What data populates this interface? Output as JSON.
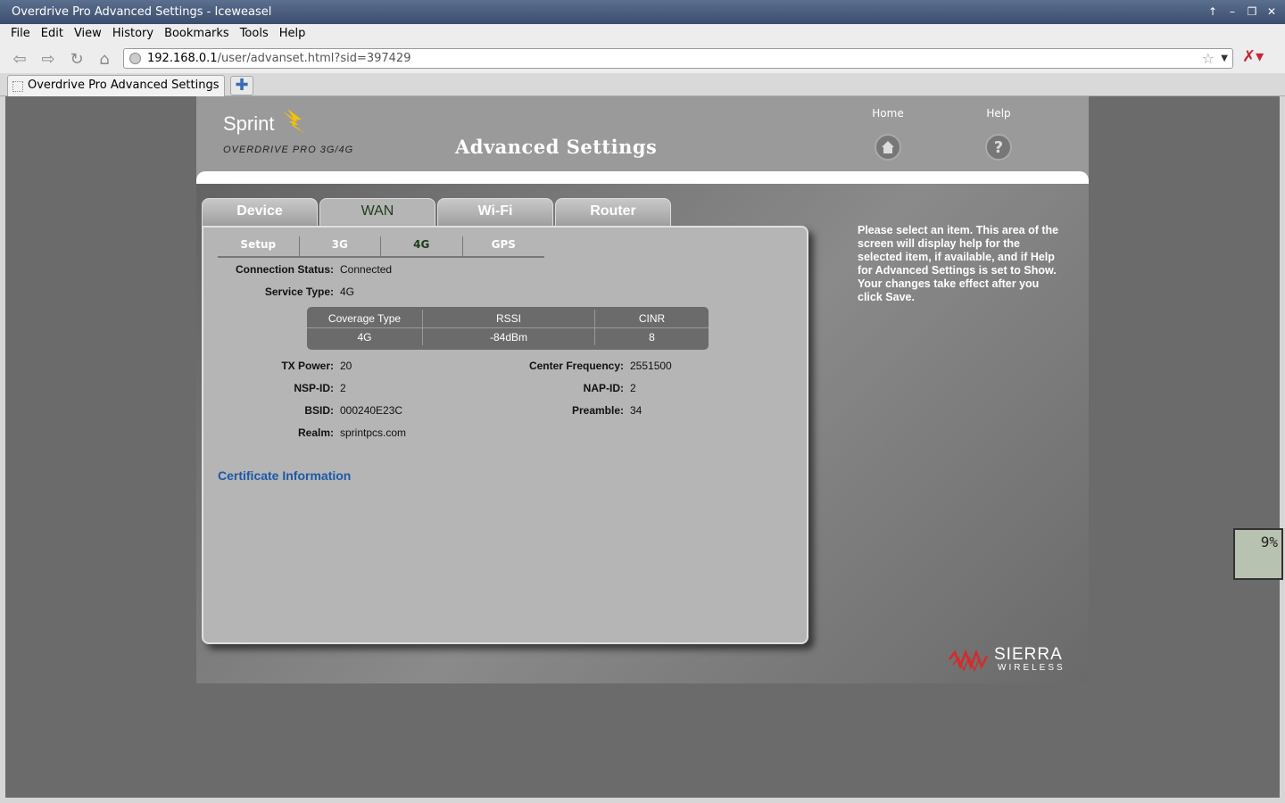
{
  "window": {
    "title": "Overdrive Pro Advanced Settings - Iceweasel"
  },
  "menu": {
    "items": [
      "File",
      "Edit",
      "View",
      "History",
      "Bookmarks",
      "Tools",
      "Help"
    ]
  },
  "nav": {
    "url_host": "192.168.0.1",
    "url_path": "/user/advanset.html?sid=397429"
  },
  "browser_tab": {
    "label": "Overdrive Pro Advanced Settings",
    "new_tab_glyph": "✚"
  },
  "page": {
    "brand": "Sprint",
    "product_logo": "OVERDRIVE PRO 3G/4G",
    "title": "Advanced Settings",
    "home_label": "Home",
    "help_label": "Help",
    "tabs": [
      "Device",
      "WAN",
      "Wi-Fi",
      "Router"
    ],
    "active_tab": "WAN",
    "subtabs": [
      "Setup",
      "3G",
      "4G",
      "GPS"
    ],
    "active_subtab": "4G",
    "connection_status_label": "Connection Status:",
    "connection_status_value": "Connected",
    "service_type_label": "Service Type:",
    "service_type_value": "4G",
    "coverage": {
      "headers": [
        "Coverage Type",
        "RSSI",
        "CINR"
      ],
      "values": [
        "4G",
        "-84dBm",
        "8"
      ]
    },
    "details": {
      "tx_power_label": "TX Power:",
      "tx_power_value": "20",
      "nsp_id_label": "NSP-ID:",
      "nsp_id_value": "2",
      "bsid_label": "BSID:",
      "bsid_value": "000240E23C",
      "realm_label": "Realm:",
      "realm_value": "sprintpcs.com",
      "center_freq_label": "Center Frequency:",
      "center_freq_value": "2551500",
      "nap_id_label": "NAP-ID:",
      "nap_id_value": "2",
      "preamble_label": "Preamble:",
      "preamble_value": "34"
    },
    "certificate_link": "Certificate Information",
    "help_text_1": "Please select an item. This area of the screen will display help for the selected item, if available, and if Help for Advanced Settings is set to Show.",
    "help_text_2": "Your changes take effect after you click Save.",
    "vendor_line1": "SIERRA",
    "vendor_line2": "WIRELESS"
  },
  "cpu_widget": {
    "percent": "9%"
  },
  "colors": {
    "link_blue": "#1b5aa6",
    "sprint_yellow": "#f5c400",
    "sierra_red": "#d22c2c"
  }
}
